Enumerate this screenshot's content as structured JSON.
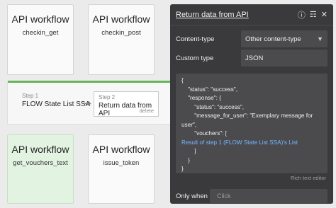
{
  "cards": [
    {
      "title": "API workflow",
      "sub": "checkin_get"
    },
    {
      "title": "API workflow",
      "sub": "checkin_post"
    },
    {
      "title": "API workflow",
      "sub": "get_vouchers_text"
    },
    {
      "title": "API workflow",
      "sub": "issue_token"
    }
  ],
  "workflow": {
    "step1_num": "Step 1",
    "step1_title": "FLOW State List SSA",
    "arrow": "➔",
    "step2_num": "Step 2",
    "step2_title": "Return data from API",
    "step2_delete": "delete"
  },
  "panel": {
    "title": "Return data from API",
    "icons": [
      "info-icon",
      "notes-icon",
      "close-icon"
    ],
    "content_type_label": "Content-type",
    "content_type_value": "Other content-type",
    "custom_type_label": "Custom type",
    "custom_type_value": "JSON",
    "code_lines": [
      "{",
      "    \"status\": \"success\",",
      "    \"response\": {",
      "        \"status\": \"success\",",
      "        \"message_for_user\": \"Exemplary message for",
      "user\",",
      "        \"vouchers\": ["
    ],
    "code_dynamic": "Result of step 1 (FLOW State List SSA)'s List",
    "code_tail": [
      "        ]",
      "    }",
      "}"
    ],
    "rich_text_label": "Rich text editor",
    "only_when_label": "Only when",
    "only_when_placeholder": "Click"
  }
}
